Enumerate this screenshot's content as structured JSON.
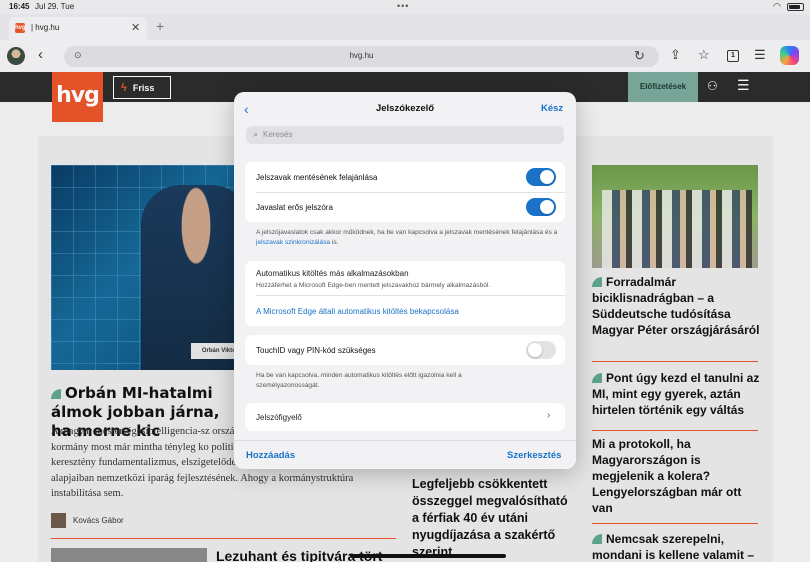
{
  "status": {
    "time": "16:45",
    "date": "Jul 29. Tue"
  },
  "browser": {
    "tab_title": "| hvg.hu",
    "favicon_text": "hvg",
    "url": "hvg.hu",
    "tab_count": "1"
  },
  "site": {
    "logo": "hvg",
    "friss_label": "Friss",
    "subscriptions_label": "Előfizetések",
    "lead_headline": "Orbán MI-hatalmi álmok jobban járna, ha merne kic",
    "lead_body": "A magyar mesterségesintelligencia-sz országok szűk szakterületi MI-fejleszt kormány most már mintha tényleg ko politikai klíma (bevándorlásellenesség, keresztény fundamentalizmus, elszigetelődés az EU-tól) aligha kedvez egy alapjaiban nemzetközi iparág fejlesztésének. Ahogy a kormánystruktúra instabilitása sem.",
    "author": "Kovács Gábor",
    "nameplate": "Orbán Viktor",
    "second_headline": "Lezuhant és tipitvára tört",
    "mid_headline": "Legfeljebb csökkentett összeggel megvalósítható a férfiak 40 év utáni nyugdíjazása a szakértő szerint",
    "right_headlines": [
      "Forradalmár biciklisnadrágban – a Süddeutsche tudósítása Magyar Péter országjárásáról",
      "Pont úgy kezd el tanulni az MI, mint egy gyerek, aztán hirtelen történik egy váltás",
      "Mi a protokoll, ha Magyarországon is megjelenik a kolera? Lengyelországban már ott van",
      "Nemcsak szerepelni, mondani is kellene valamit –"
    ]
  },
  "modal": {
    "title": "Jelszókezelő",
    "done_label": "Kész",
    "search_placeholder": "Keresés",
    "offer_save_label": "Jelszavak mentésének felajánlása",
    "offer_save_on": true,
    "suggest_strong_label": "Javaslat erős jelszóra",
    "suggest_strong_on": true,
    "suggest_note": "A jelszójavaslatok csak akkor működnek, ha be van kapcsolva a jelszavak mentésének felajánlása és a",
    "suggest_note_link": "jelszavak szinkronizálása",
    "suggest_note_end": " is.",
    "autofill_title": "Automatikus kitöltés más alkalmazásokban",
    "autofill_sub": "Hozzáférhet a Microsoft Edge-ben mentett jelszavakhoz bármely alkalmazásból.",
    "autofill_link": "A Microsoft Edge általi automatikus kitöltés bekapcsolása",
    "touchid_label": "TouchID vagy PIN-kód szükséges",
    "touchid_on": false,
    "touchid_note": "Ha be van kapcsolva, minden automatikus kitöltés előtt igazolnia kell a személyazonosságát.",
    "monitor_label": "Jelszófigyelő",
    "add_label": "Hozzáadás",
    "edit_label": "Szerkesztés"
  },
  "colors": {
    "accent": "#1a73c9",
    "brand": "#e8542a",
    "subscribe": "#7aa99b"
  }
}
